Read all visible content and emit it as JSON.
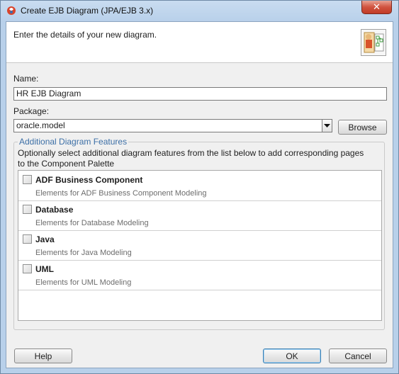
{
  "window": {
    "title": "Create EJB Diagram (JPA/EJB 3.x)",
    "close_glyph": "✕"
  },
  "header": {
    "instruction": "Enter the details of your new diagram.",
    "icon": "diagram-wizard-icon"
  },
  "form": {
    "name_label": "Name:",
    "name_value": "HR EJB Diagram",
    "package_label": "Package:",
    "package_value": "oracle.model",
    "browse_label": "Browse"
  },
  "features": {
    "group_title": "Additional Diagram Features",
    "description": "Optionally select additional diagram features from the list below to add corresponding pages to the Component Palette",
    "items": [
      {
        "title": "ADF Business Component",
        "description": "Elements for ADF Business Component Modeling",
        "checked": false
      },
      {
        "title": "Database",
        "description": "Elements for Database Modeling",
        "checked": false
      },
      {
        "title": "Java",
        "description": "Elements for Java Modeling",
        "checked": false
      },
      {
        "title": "UML",
        "description": "Elements for UML Modeling",
        "checked": false
      }
    ]
  },
  "buttons": {
    "help": "Help",
    "ok": "OK",
    "cancel": "Cancel"
  },
  "colors": {
    "group_title": "#3c6fa6",
    "close": "#c13b26",
    "titlebar": "#c9dcf0"
  }
}
